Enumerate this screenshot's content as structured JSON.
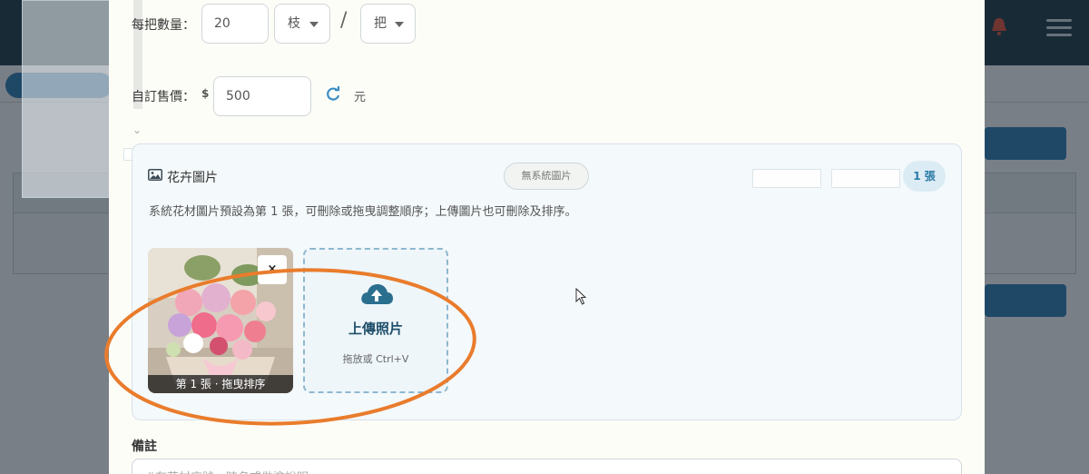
{
  "form": {
    "bundle_qty_label": "每把數量：",
    "bundle_qty_value": "20",
    "stem_unit": "枝",
    "separator": "/",
    "bundle_unit": "把",
    "custom_price_label": "自訂售價：",
    "currency_symbol": "$",
    "custom_price_value": "500",
    "price_unit": "元"
  },
  "image_section": {
    "title": "花卉圖片",
    "system_pill": "無系統圖片",
    "count_badge": "1 張",
    "hint": "系統花材圖片預設為第 1 張，可刪除或拖曳調整順序；上傳圖片也可刪除及排序。",
    "photos": [
      {
        "caption": "第 1 張 · 拖曳排序",
        "remove_label": "×"
      }
    ],
    "upload_title": "上傳照片",
    "upload_subtitle": "拖放或 Ctrl+V"
  },
  "notes": {
    "label": "備註",
    "placeholder": "#有花材序號，時名或做塗說明"
  },
  "colors": {
    "accent": "#2a7aa6",
    "annotation": "#e97c2c",
    "modal_bg": "#fdfdf8",
    "topbar": "#1f3a4a"
  },
  "icons": {
    "section": "image-icon",
    "refresh": "refresh-icon",
    "upload": "cloud-upload-icon"
  }
}
